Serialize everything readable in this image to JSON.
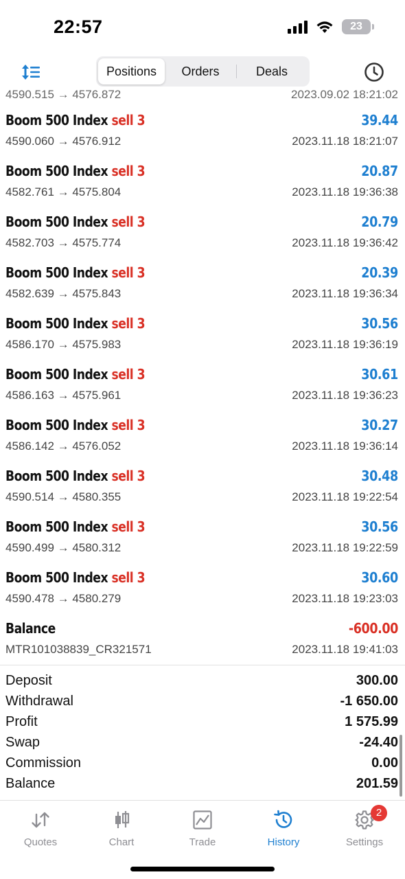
{
  "status_bar": {
    "time": "22:57",
    "battery": "23"
  },
  "top_nav": {
    "tabs": [
      {
        "label": "Positions",
        "active": true
      },
      {
        "label": "Orders",
        "active": false
      },
      {
        "label": "Deals",
        "active": false
      }
    ]
  },
  "deals": [
    {
      "symbol": "Boom 500 Index",
      "action": "sell 3",
      "prices": "4590.060 → 4576.912",
      "profit": "39.44",
      "date": "2023.11.18 18:21:07"
    },
    {
      "symbol": "Boom 500 Index",
      "action": "sell 3",
      "prices": "4582.761 → 4575.804",
      "profit": "20.87",
      "date": "2023.11.18 19:36:38"
    },
    {
      "symbol": "Boom 500 Index",
      "action": "sell 3",
      "prices": "4582.703 → 4575.774",
      "profit": "20.79",
      "date": "2023.11.18 19:36:42"
    },
    {
      "symbol": "Boom 500 Index",
      "action": "sell 3",
      "prices": "4582.639 → 4575.843",
      "profit": "20.39",
      "date": "2023.11.18 19:36:34"
    },
    {
      "symbol": "Boom 500 Index",
      "action": "sell 3",
      "prices": "4586.170 → 4575.983",
      "profit": "30.56",
      "date": "2023.11.18 19:36:19"
    },
    {
      "symbol": "Boom 500 Index",
      "action": "sell 3",
      "prices": "4586.163 → 4575.961",
      "profit": "30.61",
      "date": "2023.11.18 19:36:23"
    },
    {
      "symbol": "Boom 500 Index",
      "action": "sell 3",
      "prices": "4586.142 → 4576.052",
      "profit": "30.27",
      "date": "2023.11.18 19:36:14"
    },
    {
      "symbol": "Boom 500 Index",
      "action": "sell 3",
      "prices": "4590.514 → 4580.355",
      "profit": "30.48",
      "date": "2023.11.18 19:22:54"
    },
    {
      "symbol": "Boom 500 Index",
      "action": "sell 3",
      "prices": "4590.499 → 4580.312",
      "profit": "30.56",
      "date": "2023.11.18 19:22:59"
    },
    {
      "symbol": "Boom 500 Index",
      "action": "sell 3",
      "prices": "4590.478 → 4580.279",
      "profit": "30.60",
      "date": "2023.11.18 19:23:03"
    }
  ],
  "balance_entry": {
    "title": "Balance",
    "comment": "MTR101038839_CR321571",
    "amount": "-600.00",
    "date": "2023.11.18 19:41:03"
  },
  "summary": [
    {
      "label": "Deposit",
      "value": "300.00"
    },
    {
      "label": "Withdrawal",
      "value": "-1 650.00"
    },
    {
      "label": "Profit",
      "value": "1 575.99"
    },
    {
      "label": "Swap",
      "value": "-24.40"
    },
    {
      "label": "Commission",
      "value": "0.00"
    },
    {
      "label": "Balance",
      "value": "201.59"
    }
  ],
  "tab_bar": {
    "tabs": [
      {
        "label": "Quotes",
        "icon": "quotes-arrows-icon"
      },
      {
        "label": "Chart",
        "icon": "candlestick-icon"
      },
      {
        "label": "Trade",
        "icon": "trade-chart-icon"
      },
      {
        "label": "History",
        "icon": "history-clock-icon",
        "active": true
      },
      {
        "label": "Settings",
        "icon": "gear-icon",
        "badge": "2"
      }
    ]
  },
  "colors": {
    "accent": "#1e7fd0",
    "sell": "#d93025",
    "negative": "#d93025"
  }
}
